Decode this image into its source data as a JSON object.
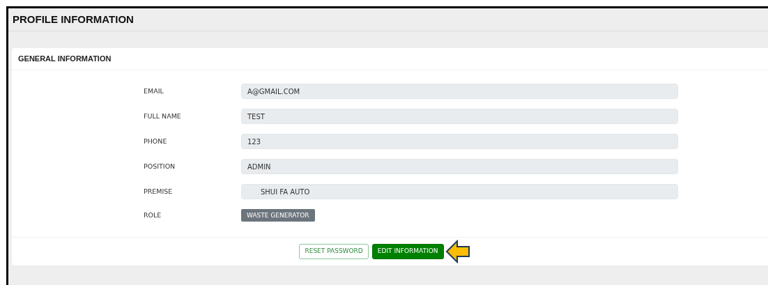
{
  "page": {
    "title": "PROFILE INFORMATION"
  },
  "card": {
    "title": "GENERAL INFORMATION",
    "fields": [
      {
        "label": "EMAIL",
        "value": "A@GMAIL.COM",
        "kind": "text"
      },
      {
        "label": "FULL NAME",
        "value": "TEST",
        "kind": "text"
      },
      {
        "label": "PHONE",
        "value": "123",
        "kind": "text"
      },
      {
        "label": "POSITION",
        "value": "ADMIN",
        "kind": "text"
      },
      {
        "label": "PREMISE",
        "value": "SHUI FA AUTO",
        "kind": "select"
      },
      {
        "label": "ROLE",
        "value": "WASTE GENERATOR",
        "kind": "badge"
      }
    ],
    "buttons": [
      {
        "label": "RESET PASSWORD",
        "kind": "outline"
      },
      {
        "label": "EDIT INFORMATION",
        "kind": "primary"
      }
    ]
  }
}
